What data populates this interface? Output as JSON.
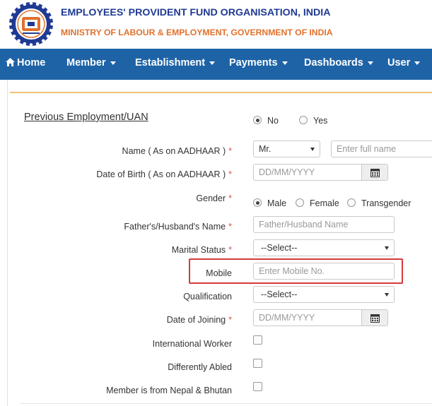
{
  "header": {
    "org_name": "EMPLOYEES' PROVIDENT FUND ORGANISATION, INDIA",
    "ministry": "MINISTRY OF LABOUR & EMPLOYMENT, GOVERNMENT OF INDIA",
    "brand_color": "#1f3a93",
    "accent_color": "#e0712c"
  },
  "nav": {
    "home": "Home",
    "member": "Member",
    "establishment": "Establishment",
    "payments": "Payments",
    "dashboards": "Dashboards",
    "user": "User",
    "bar_color": "#1e63a6"
  },
  "form": {
    "prev_employment": {
      "label": "Previous Employment/UAN",
      "options": [
        "No",
        "Yes"
      ],
      "selected": "No"
    },
    "name": {
      "label": "Name ( As on AADHAAR )",
      "title_value": "Mr.",
      "placeholder": "Enter full name"
    },
    "dob": {
      "label": "Date of Birth ( As on AADHAAR )",
      "placeholder": "DD/MM/YYYY"
    },
    "gender": {
      "label": "Gender",
      "options": [
        "Male",
        "Female",
        "Transgender"
      ],
      "selected": "Male"
    },
    "father": {
      "label": "Father's/Husband's Name",
      "placeholder": "Father/Husband Name"
    },
    "marital": {
      "label": "Marital Status",
      "value": "--Select--"
    },
    "mobile": {
      "label": "Mobile",
      "placeholder": "Enter Mobile No."
    },
    "qualification": {
      "label": "Qualification",
      "value": "--Select--"
    },
    "doj": {
      "label": "Date of Joining",
      "placeholder": "DD/MM/YYYY"
    },
    "international": {
      "label": "International Worker"
    },
    "disabled": {
      "label": "Differently Abled"
    },
    "nepal": {
      "label": "Member is from Nepal & Bhutan"
    },
    "required_mark": "*"
  }
}
